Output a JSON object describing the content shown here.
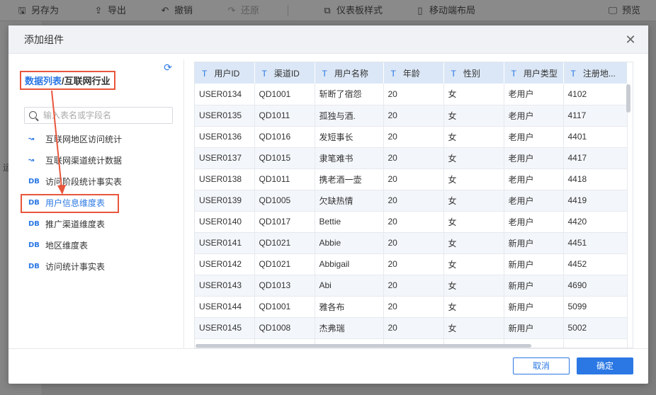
{
  "toolbar": {
    "items": [
      {
        "label": "另存为",
        "icon": "save-icon",
        "glyph": "🖫"
      },
      {
        "label": "导出",
        "icon": "export-icon",
        "glyph": "⇪"
      },
      {
        "label": "撤销",
        "icon": "undo-icon",
        "glyph": "↶"
      },
      {
        "label": "还原",
        "icon": "redo-icon",
        "glyph": "↷"
      },
      {
        "label": "仪表板样式",
        "icon": "dashboard-style-icon",
        "glyph": "⧉"
      },
      {
        "label": "移动端布局",
        "icon": "mobile-icon",
        "glyph": "▯"
      },
      {
        "label": "预览",
        "icon": "preview-icon",
        "glyph": "🖵"
      }
    ],
    "left_fragment": "运"
  },
  "dialog": {
    "title": "添加组件",
    "close_icon": "close-icon",
    "breadcrumb": {
      "root": "数据列表",
      "separator": "/",
      "current": "互联网行业"
    },
    "search_placeholder": "输入表名或字段名",
    "tree": [
      {
        "label": "互联网地区访问统计",
        "icon": "trend-icon",
        "glyph": "↝"
      },
      {
        "label": "互联网渠道统计数据",
        "icon": "trend-icon",
        "glyph": "↝"
      },
      {
        "label": "访问阶段统计事实表",
        "icon": "db-icon",
        "glyph": "DB"
      },
      {
        "label": "用户信息维度表",
        "icon": "db-icon",
        "glyph": "DB",
        "selected": true
      },
      {
        "label": "推广渠道维度表",
        "icon": "db-icon",
        "glyph": "DB"
      },
      {
        "label": "地区维度表",
        "icon": "db-icon",
        "glyph": "DB"
      },
      {
        "label": "访问统计事实表",
        "icon": "db-icon",
        "glyph": "DB"
      }
    ],
    "table": {
      "type_glyph": "T",
      "columns": [
        "用户ID",
        "渠道ID",
        "用户名称",
        "年龄",
        "性别",
        "用户类型",
        "注册地..."
      ],
      "rows": [
        [
          "USER0134",
          "QD1001",
          "斩断了宿怨",
          "20",
          "女",
          "老用户",
          "4102"
        ],
        [
          "USER0135",
          "QD1011",
          "孤独与酒.",
          "20",
          "女",
          "老用户",
          "4117"
        ],
        [
          "USER0136",
          "QD1016",
          "发短事长",
          "20",
          "女",
          "老用户",
          "4401"
        ],
        [
          "USER0137",
          "QD1015",
          "隶笔难书",
          "20",
          "女",
          "老用户",
          "4417"
        ],
        [
          "USER0138",
          "QD1011",
          "携老酒一壶",
          "20",
          "女",
          "老用户",
          "4418"
        ],
        [
          "USER0139",
          "QD1005",
          "欠缺热情",
          "20",
          "女",
          "老用户",
          "4419"
        ],
        [
          "USER0140",
          "QD1017",
          "Bettie",
          "20",
          "女",
          "老用户",
          "4420"
        ],
        [
          "USER0141",
          "QD1021",
          "Abbie",
          "20",
          "女",
          "新用户",
          "4451"
        ],
        [
          "USER0142",
          "QD1021",
          "Abbigail",
          "20",
          "女",
          "新用户",
          "4452"
        ],
        [
          "USER0143",
          "QD1013",
          "Abi",
          "20",
          "女",
          "新用户",
          "4690"
        ],
        [
          "USER0144",
          "QD1001",
          "雅各布",
          "20",
          "女",
          "新用户",
          "5099"
        ],
        [
          "USER0145",
          "QD1008",
          "杰弗瑞",
          "20",
          "女",
          "新用户",
          "5002"
        ],
        [
          "",
          "",
          "",
          "",
          "",
          "",
          ""
        ]
      ]
    },
    "buttons": {
      "cancel": "取消",
      "ok": "确定"
    },
    "colors": {
      "accent": "#2b78e4",
      "annotation": "#e8563c",
      "header_bg": "#dbe7f6"
    }
  }
}
